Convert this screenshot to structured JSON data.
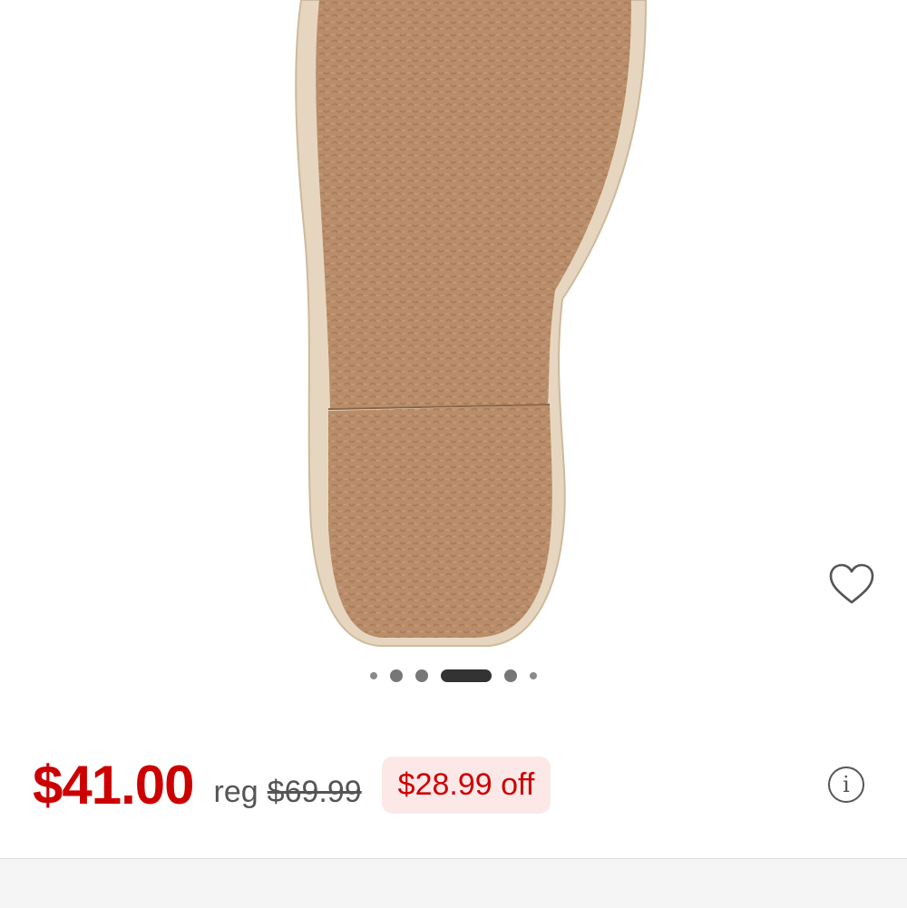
{
  "product_image": {
    "subject": "espadrille-sole",
    "colors": {
      "sole": "#b98d6a",
      "sole_shadow": "#a67b59",
      "jute": "#e6d6bf",
      "jute_line": "#cdb99c"
    }
  },
  "favorite": {
    "icon": "heart-outline-icon"
  },
  "carousel": {
    "total": 6,
    "active_index": 3
  },
  "pricing": {
    "current_price": "$41.00",
    "reg_label": "reg",
    "regular_price": "$69.99",
    "savings": "$28.99 off",
    "colors": {
      "price": "#cc0000",
      "savings_bg": "#fde8e8"
    }
  },
  "info_button": {
    "icon": "info-icon",
    "glyph": "i"
  }
}
